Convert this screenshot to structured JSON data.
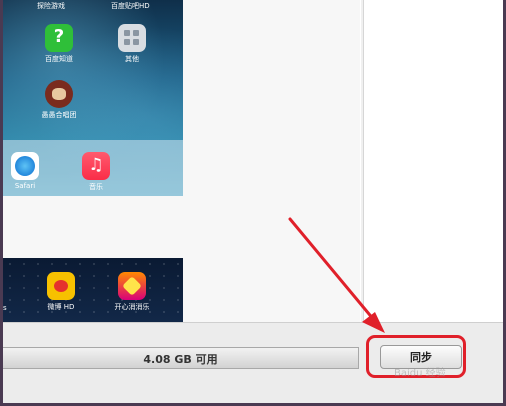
{
  "ios_home": {
    "top_labels": [
      "探险游戏",
      "百度贴吧HD"
    ],
    "apps": [
      {
        "label": "百度知道",
        "icon": "baidu-zhidao-icon"
      },
      {
        "label": "其他",
        "icon": "app-folder-icon"
      },
      {
        "label": "愚愚合唱团",
        "icon": "game-face-icon"
      }
    ],
    "dock": [
      {
        "label": "Safari",
        "icon": "safari-icon"
      },
      {
        "label": "音乐",
        "icon": "music-icon"
      }
    ]
  },
  "ios_home_2": {
    "left_fragment": "s",
    "apps": [
      {
        "label": "微博 HD",
        "icon": "weibo-icon"
      },
      {
        "label": "开心消消乐",
        "icon": "xiaoxiao-icon"
      }
    ]
  },
  "capacity": {
    "text": "4.08 GB 可用"
  },
  "sync": {
    "label": "同步"
  },
  "watermark": {
    "text": "Baidu 经验"
  },
  "colors": {
    "highlight": "#e0202a",
    "arrow": "#e0202a"
  }
}
